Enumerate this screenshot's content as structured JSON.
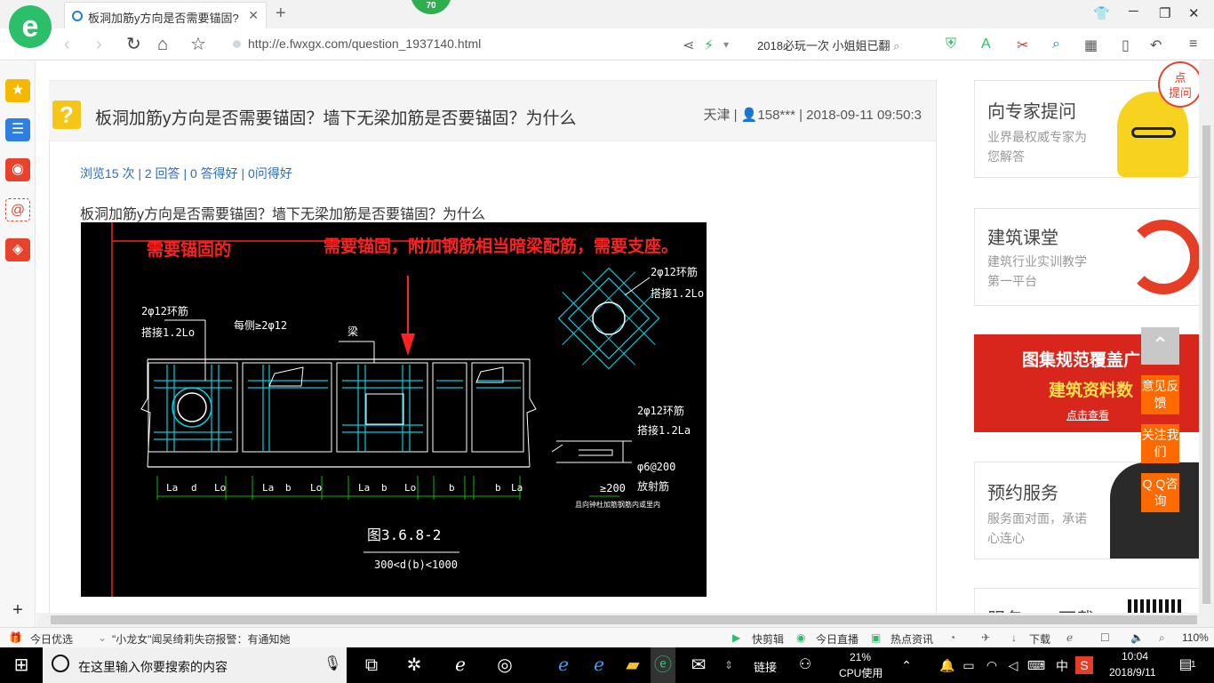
{
  "browser": {
    "tab_title": "板洞加筋y方向是否需要锚固?",
    "tab_close": "✕",
    "new_tab": "+",
    "badge": "70",
    "url": "http://e.fwxgx.com/question_1937140.html",
    "search_text": "2018必玩一次 小姐姐已翻"
  },
  "question": {
    "title": "板洞加筋y方向是否需要锚固？墙下无梁加筋是否要锚固？为什么",
    "meta": "天津 | 👤158*** | 2018-09-11 09:50:3",
    "stats": "浏览15 次 | 2 回答 | 0 答得好 | 0问得好",
    "body": "板洞加筋y方向是否需要锚固？墙下无梁加筋是否要锚固？为什么"
  },
  "drawing": {
    "red_label_left": "需要锚固的",
    "red_label_main": "需要锚固，附加钢筋相当暗梁配筋，需要支座。",
    "ring_bar_1": "2φ12环筋",
    "lap_1": "搭接1.2Lo",
    "each_side": "每侧≥2φ12",
    "beam": "梁",
    "ring_bar_2": "2φ12环筋",
    "lap_2": "搭接1.2Lo",
    "ring_bar_3": "2φ12环筋",
    "lap_3": "搭接1.2La",
    "stirrup": "φ6@200",
    "radial": "放射筋",
    "ge200": "≥200",
    "small_note": "且向钟杜加筋钢筋内或里内",
    "fig_no": "图3.6.8-2",
    "fig_range": "300<d(b)<1000",
    "dims": [
      "La",
      "d",
      "Lo",
      "La",
      "b",
      "Lo",
      "La",
      "b",
      "Lo",
      "b",
      "b",
      "La"
    ]
  },
  "right_rail": {
    "card1_title": "向专家提问",
    "card1_sub": "业界最权威专家为您解答",
    "card2_title": "建筑课堂",
    "card2_sub": "建筑行业实训教学第一平台",
    "banner_line1": "图集规范覆盖广",
    "banner_line2": "建筑资料数",
    "banner_btn": "点击查看",
    "card3_title": "预约服务",
    "card3_sub": "服务面对面，承诺心连心",
    "card4_title": "服务APP下载",
    "corner_text": "点\n提问"
  },
  "floats": [
    "意见反馈",
    "关注我们",
    "Q Q咨询"
  ],
  "statusbar": {
    "daily": "今日优选",
    "news": "\"小龙女\"闻吴绮莉失窃报警：有通知她",
    "clip": "快剪辑",
    "live": "今日直播",
    "hot": "热点资讯",
    "download": "下载",
    "zoom": "110%"
  },
  "taskbar": {
    "search_placeholder": "在这里输入你要搜索的内容",
    "link": "链接",
    "cpu_pct": "21%",
    "cpu_label": "CPU使用",
    "ime": "中",
    "time": "10:04",
    "date": "2018/9/11",
    "notif": "1"
  },
  "colors": {
    "accent_green": "#2bbf6a",
    "link_blue": "#2e6bbd",
    "cad_red": "#ff2020",
    "cad_cyan": "#00d0e0",
    "orange": "#ff6a00"
  }
}
